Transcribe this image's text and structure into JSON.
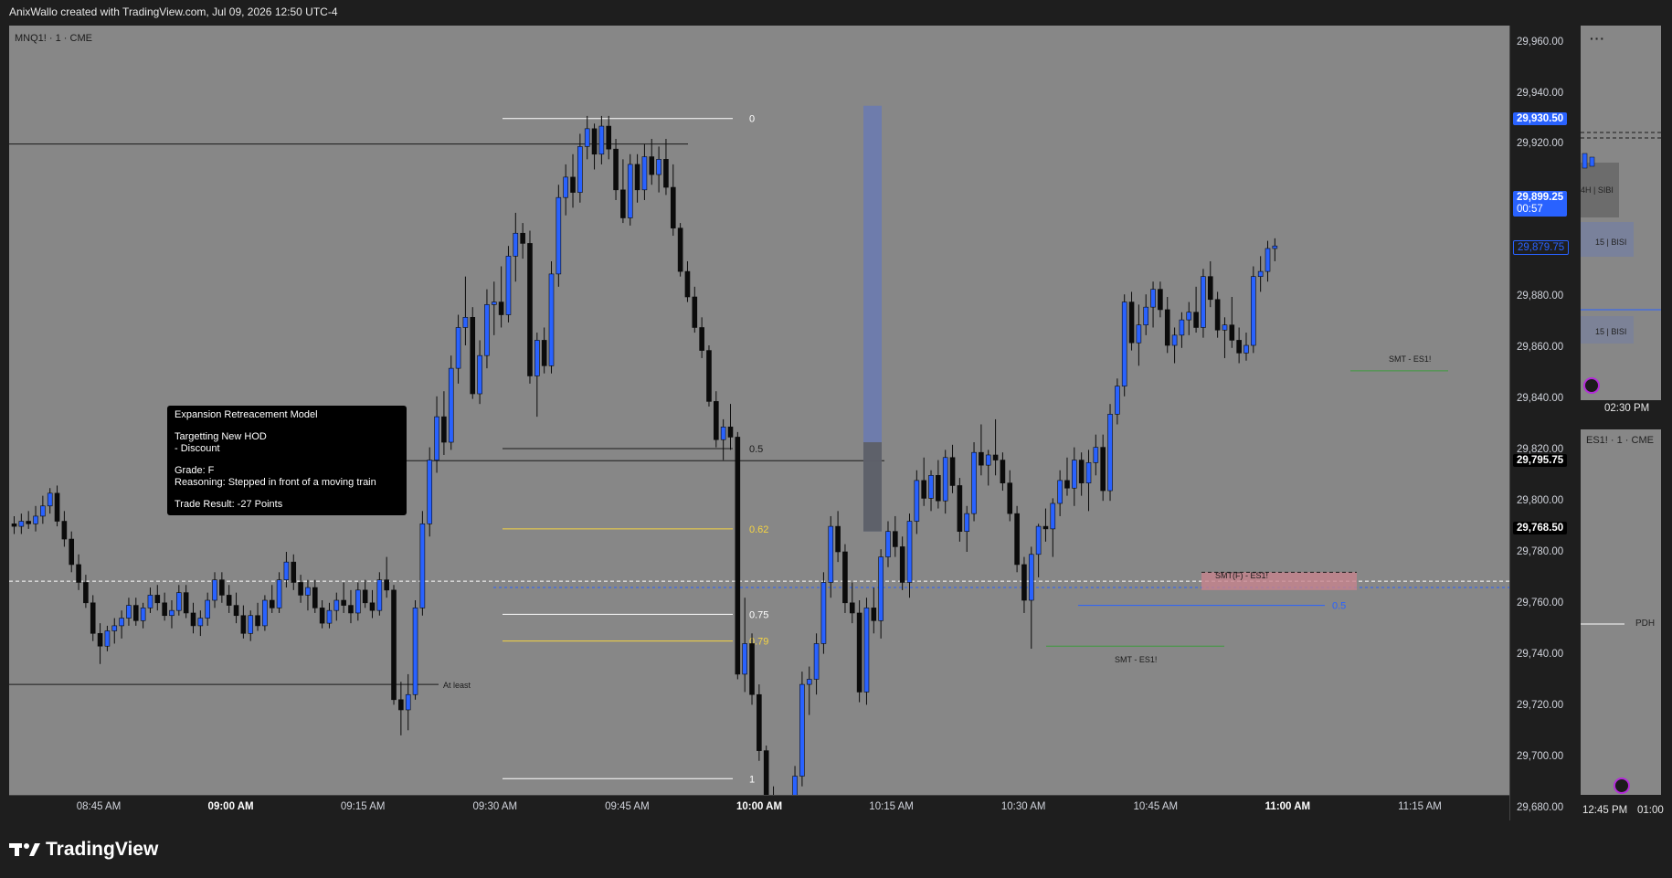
{
  "header": {
    "text": "AnixWallo created with TradingView.com, Jul 09, 2026 12:50 UTC-4"
  },
  "symbol": {
    "main": "MNQ1! · 1 · CME",
    "secondary": "ES1! · 1 · CME"
  },
  "info_box": {
    "title": "Expansion Retreacement Model",
    "line1": "Targetting New HOD",
    "line2": "- Discount",
    "line3": "Grade: F",
    "line4": "Reasoning: Stepped in front of a moving train",
    "line5": "Trade Result: -27 Points"
  },
  "fib_labels": {
    "l0": "0",
    "l05": "0.5",
    "l062": "0.62",
    "l075": "0.75",
    "l079": "0.79",
    "l1": "1"
  },
  "annotations": {
    "at_least": "At least",
    "smt1": "SMT - ES1!",
    "smt2": "SMT - ES1!",
    "smt_f": "SMT(F) - ES1!",
    "half": "0.5"
  },
  "price_axis": [
    "29,960.00",
    "29,940.00",
    "29,920.00",
    "29,880.00",
    "29,860.00",
    "29,840.00",
    "29,820.00",
    "29,800.00",
    "29,780.00",
    "29,760.00",
    "29,740.00",
    "29,720.00",
    "29,700.00",
    "29,680.00"
  ],
  "price_tags": {
    "high": "29,930.50",
    "last": "29,899.25",
    "countdown": "00:57",
    "blue": "29,879.75",
    "black1": "29,795.75",
    "black2": "29,768.50"
  },
  "time_axis": [
    {
      "label": "08:45 AM",
      "bold": false
    },
    {
      "label": "09:00 AM",
      "bold": true
    },
    {
      "label": "09:15 AM",
      "bold": false
    },
    {
      "label": "09:30 AM",
      "bold": false
    },
    {
      "label": "09:45 AM",
      "bold": false
    },
    {
      "label": "10:00 AM",
      "bold": true
    },
    {
      "label": "10:15 AM",
      "bold": false
    },
    {
      "label": "10:30 AM",
      "bold": false
    },
    {
      "label": "10:45 AM",
      "bold": false
    },
    {
      "label": "11:00 AM",
      "bold": true
    },
    {
      "label": "11:15 AM",
      "bold": false
    }
  ],
  "side_panel": {
    "menu": "···",
    "label_4h": "4H | SIBI",
    "label_15a": "15 | BISI",
    "label_15b": "15 | BISI",
    "time1": "02:30 PM",
    "pdh": "PDH",
    "time2a": "12:45 PM",
    "time2b": "01:00"
  },
  "footer": {
    "brand": "TradingView"
  },
  "colors": {
    "bull": "#2962ff",
    "bear": "#0b0b0b",
    "pane": "#878787",
    "fib_gold": "#f5d442",
    "highlight": "#6c7bb0"
  },
  "chart_data": {
    "type": "candlestick",
    "symbol": "MNQ1!",
    "interval": "1m",
    "ylim": [
      29660,
      29970
    ],
    "fib_levels": [
      {
        "level": "0",
        "price": 29930
      },
      {
        "level": "0.5",
        "price": 29800.5
      },
      {
        "level": "0.62",
        "price": 29769
      },
      {
        "level": "0.75",
        "price": 29735.5
      },
      {
        "level": "0.79",
        "price": 29725
      },
      {
        "level": "1",
        "price": 29671
      }
    ],
    "candles": [
      [
        29771,
        29774,
        29767,
        29770
      ],
      [
        29770,
        29775,
        29767,
        29772
      ],
      [
        29772,
        29776,
        29769,
        29771
      ],
      [
        29771,
        29778,
        29768,
        29774
      ],
      [
        29774,
        29782,
        29771,
        29778
      ],
      [
        29778,
        29785,
        29775,
        29783
      ],
      [
        29783,
        29786,
        29770,
        29772
      ],
      [
        29772,
        29776,
        29762,
        29765
      ],
      [
        29765,
        29768,
        29752,
        29755
      ],
      [
        29755,
        29759,
        29745,
        29748
      ],
      [
        29748,
        29751,
        29738,
        29740
      ],
      [
        29740,
        29743,
        29725,
        29728
      ],
      [
        29728,
        29732,
        29716,
        29723
      ],
      [
        29723,
        29731,
        29721,
        29729
      ],
      [
        29729,
        29734,
        29724,
        29731
      ],
      [
        29731,
        29737,
        29726,
        29734
      ],
      [
        29734,
        29742,
        29731,
        29739
      ],
      [
        29739,
        29742,
        29731,
        29733
      ],
      [
        29733,
        29740,
        29730,
        29738
      ],
      [
        29738,
        29746,
        29736,
        29743
      ],
      [
        29743,
        29747,
        29737,
        29740
      ],
      [
        29740,
        29744,
        29733,
        29735
      ],
      [
        29735,
        29741,
        29730,
        29737
      ],
      [
        29737,
        29747,
        29735,
        29744
      ],
      [
        29744,
        29747,
        29734,
        29736
      ],
      [
        29736,
        29740,
        29728,
        29731
      ],
      [
        29731,
        29737,
        29727,
        29734
      ],
      [
        29734,
        29744,
        29731,
        29741
      ],
      [
        29741,
        29752,
        29738,
        29749
      ],
      [
        29749,
        29752,
        29740,
        29743
      ],
      [
        29743,
        29747,
        29736,
        29739
      ],
      [
        29739,
        29744,
        29732,
        29735
      ],
      [
        29735,
        29739,
        29726,
        29728
      ],
      [
        29728,
        29737,
        29725,
        29735
      ],
      [
        29735,
        29740,
        29729,
        29731
      ],
      [
        29731,
        29743,
        29729,
        29741
      ],
      [
        29741,
        29747,
        29736,
        29738
      ],
      [
        29738,
        29752,
        29736,
        29749
      ],
      [
        29749,
        29760,
        29746,
        29756
      ],
      [
        29756,
        29759,
        29745,
        29748
      ],
      [
        29748,
        29751,
        29740,
        29743
      ],
      [
        29743,
        29749,
        29737,
        29746
      ],
      [
        29746,
        29749,
        29736,
        29738
      ],
      [
        29738,
        29741,
        29730,
        29732
      ],
      [
        29732,
        29740,
        29730,
        29737
      ],
      [
        29737,
        29744,
        29733,
        29741
      ],
      [
        29741,
        29748,
        29736,
        29739
      ],
      [
        29739,
        29745,
        29732,
        29736
      ],
      [
        29736,
        29748,
        29733,
        29745
      ],
      [
        29745,
        29749,
        29738,
        29740
      ],
      [
        29740,
        29745,
        29734,
        29737
      ],
      [
        29737,
        29752,
        29735,
        29749
      ],
      [
        29749,
        29758,
        29742,
        29745
      ],
      [
        29745,
        29747,
        29700,
        29702
      ],
      [
        29702,
        29709,
        29688,
        29698
      ],
      [
        29698,
        29712,
        29690,
        29704
      ],
      [
        29704,
        29741,
        29702,
        29738
      ],
      [
        29738,
        29776,
        29735,
        29771
      ],
      [
        29771,
        29801,
        29766,
        29796
      ],
      [
        29796,
        29821,
        29791,
        29813
      ],
      [
        29813,
        29823,
        29798,
        29803
      ],
      [
        29803,
        29837,
        29800,
        29832
      ],
      [
        29832,
        29853,
        29826,
        29848
      ],
      [
        29848,
        29868,
        29841,
        29852
      ],
      [
        29852,
        29856,
        29820,
        29822
      ],
      [
        29822,
        29843,
        29818,
        29837
      ],
      [
        29837,
        29863,
        29832,
        29857
      ],
      [
        29857,
        29866,
        29845,
        29858
      ],
      [
        29858,
        29872,
        29848,
        29853
      ],
      [
        29853,
        29880,
        29850,
        29876
      ],
      [
        29876,
        29893,
        29866,
        29885
      ],
      [
        29885,
        29889,
        29875,
        29881
      ],
      [
        29881,
        29886,
        29826,
        29829
      ],
      [
        29829,
        29846,
        29813,
        29843
      ],
      [
        29843,
        29848,
        29830,
        29833
      ],
      [
        29833,
        29874,
        29830,
        29869
      ],
      [
        29869,
        29904,
        29864,
        29899
      ],
      [
        29899,
        29912,
        29892,
        29907
      ],
      [
        29907,
        29916,
        29895,
        29901
      ],
      [
        29901,
        29924,
        29897,
        29919
      ],
      [
        29919,
        29931,
        29914,
        29926
      ],
      [
        29926,
        29928,
        29910,
        29916
      ],
      [
        29916,
        29931,
        29912,
        29927
      ],
      [
        29927,
        29931,
        29914,
        29918
      ],
      [
        29918,
        29922,
        29898,
        29902
      ],
      [
        29902,
        29914,
        29889,
        29891
      ],
      [
        29891,
        29916,
        29888,
        29912
      ],
      [
        29912,
        29916,
        29897,
        29902
      ],
      [
        29902,
        29920,
        29898,
        29915
      ],
      [
        29915,
        29922,
        29904,
        29908
      ],
      [
        29908,
        29919,
        29901,
        29914
      ],
      [
        29914,
        29922,
        29900,
        29903
      ],
      [
        29903,
        29912,
        29884,
        29887
      ],
      [
        29887,
        29889,
        29868,
        29870
      ],
      [
        29870,
        29874,
        29858,
        29860
      ],
      [
        29860,
        29864,
        29846,
        29848
      ],
      [
        29848,
        29852,
        29836,
        29839
      ],
      [
        29839,
        29841,
        29817,
        29819
      ],
      [
        29819,
        29823,
        29801,
        29804
      ],
      [
        29804,
        29812,
        29796,
        29809
      ],
      [
        29809,
        29818,
        29800,
        29805
      ],
      [
        29805,
        29807,
        29710,
        29712
      ],
      [
        29712,
        29742,
        29705,
        29724
      ],
      [
        29724,
        29728,
        29700,
        29704
      ],
      [
        29704,
        29708,
        29678,
        29682
      ],
      [
        29682,
        29684,
        29660,
        29664
      ],
      [
        29664,
        29668,
        29655,
        29660
      ],
      [
        29660,
        29664,
        29648,
        29652
      ],
      [
        29652,
        29660,
        29640,
        29656
      ],
      [
        29656,
        29676,
        29650,
        29672
      ],
      [
        29672,
        29713,
        29668,
        29708
      ],
      [
        29708,
        29715,
        29696,
        29710
      ],
      [
        29710,
        29728,
        29704,
        29724
      ],
      [
        29724,
        29752,
        29720,
        29748
      ],
      [
        29748,
        29774,
        29742,
        29770
      ],
      [
        29770,
        29776,
        29756,
        29760
      ],
      [
        29760,
        29763,
        29736,
        29740
      ],
      [
        29740,
        29748,
        29732,
        29736
      ],
      [
        29736,
        29741,
        29701,
        29705
      ],
      [
        29705,
        29742,
        29700,
        29738
      ],
      [
        29738,
        29746,
        29728,
        29733
      ],
      [
        29733,
        29761,
        29726,
        29758
      ],
      [
        29758,
        29772,
        29754,
        29768
      ],
      [
        29768,
        29774,
        29758,
        29762
      ],
      [
        29762,
        29766,
        29745,
        29748
      ],
      [
        29748,
        29775,
        29742,
        29772
      ],
      [
        29772,
        29792,
        29767,
        29788
      ],
      [
        29788,
        29797,
        29778,
        29781
      ],
      [
        29781,
        29792,
        29776,
        29790
      ],
      [
        29790,
        29796,
        29777,
        29780
      ],
      [
        29780,
        29800,
        29775,
        29797
      ],
      [
        29797,
        29802,
        29783,
        29786
      ],
      [
        29786,
        29789,
        29764,
        29768
      ],
      [
        29768,
        29778,
        29760,
        29775
      ],
      [
        29775,
        29803,
        29772,
        29799
      ],
      [
        29799,
        29810,
        29790,
        29794
      ],
      [
        29794,
        29800,
        29786,
        29798
      ],
      [
        29798,
        29812,
        29790,
        29796
      ],
      [
        29796,
        29799,
        29784,
        29787
      ],
      [
        29787,
        29792,
        29772,
        29775
      ],
      [
        29775,
        29778,
        29752,
        29755
      ],
      [
        29755,
        29758,
        29736,
        29741
      ],
      [
        29741,
        29762,
        29722,
        29759
      ],
      [
        29759,
        29771,
        29750,
        29770
      ],
      [
        29770,
        29777,
        29764,
        29769
      ],
      [
        29769,
        29781,
        29758,
        29779
      ],
      [
        29779,
        29792,
        29774,
        29788
      ],
      [
        29788,
        29797,
        29782,
        29785
      ],
      [
        29785,
        29801,
        29778,
        29796
      ],
      [
        29796,
        29799,
        29782,
        29787
      ],
      [
        29787,
        29800,
        29776,
        29795
      ],
      [
        29795,
        29806,
        29790,
        29801
      ],
      [
        29801,
        29806,
        29780,
        29784
      ],
      [
        29784,
        29818,
        29780,
        29814
      ],
      [
        29814,
        29828,
        29810,
        29825
      ],
      [
        29825,
        29861,
        29821,
        29858
      ],
      [
        29858,
        29862,
        29839,
        29842
      ],
      [
        29842,
        29857,
        29833,
        29849
      ],
      [
        29849,
        29861,
        29845,
        29856
      ],
      [
        29856,
        29866,
        29848,
        29863
      ],
      [
        29863,
        29866,
        29852,
        29855
      ],
      [
        29855,
        29860,
        29838,
        29841
      ],
      [
        29841,
        29848,
        29834,
        29845
      ],
      [
        29845,
        29854,
        29840,
        29851
      ],
      [
        29851,
        29858,
        29845,
        29854
      ],
      [
        29854,
        29864,
        29846,
        29848
      ],
      [
        29848,
        29871,
        29844,
        29868
      ],
      [
        29868,
        29874,
        29856,
        29859
      ],
      [
        29859,
        29862,
        29844,
        29847
      ],
      [
        29847,
        29852,
        29836,
        29849
      ],
      [
        29849,
        29860,
        29840,
        29843
      ],
      [
        29843,
        29848,
        29834,
        29838
      ],
      [
        29838,
        29846,
        29835,
        29841
      ],
      [
        29841,
        29872,
        29838,
        29868
      ],
      [
        29868,
        29876,
        29862,
        29870
      ],
      [
        29870,
        29882,
        29866,
        29879
      ],
      [
        29879,
        29883,
        29874,
        29880
      ]
    ]
  }
}
